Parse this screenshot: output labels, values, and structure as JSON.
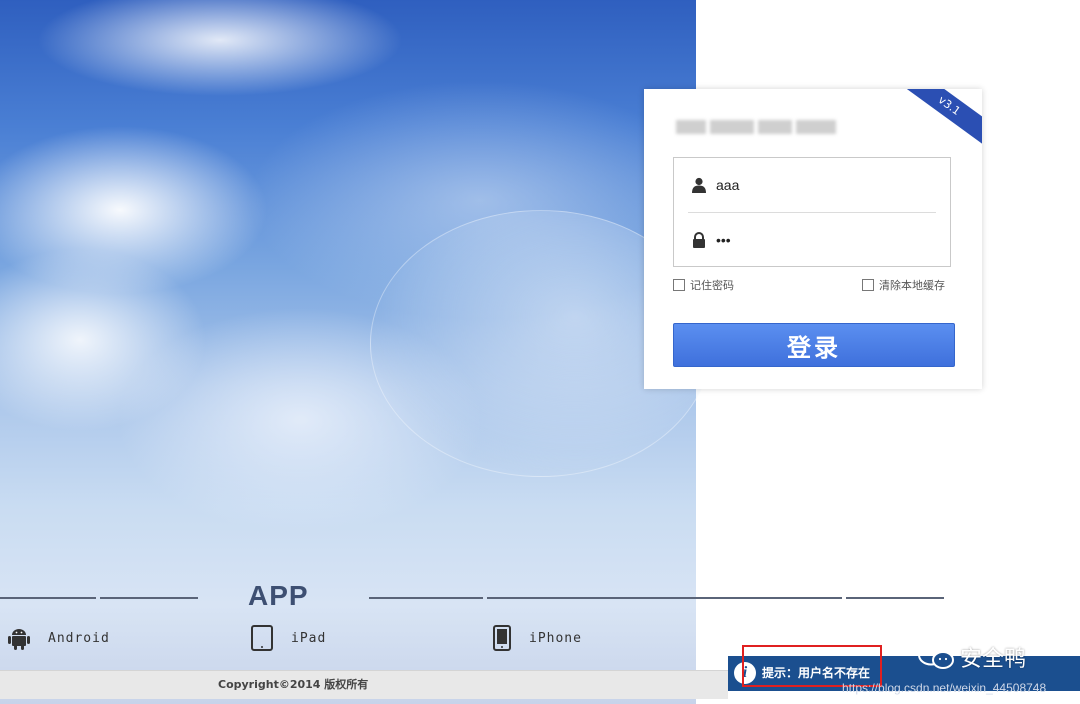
{
  "login": {
    "version_badge": "v3.1",
    "username_value": "aaa",
    "password_value": "•••",
    "remember_label": "记住密码",
    "clear_cache_label": "清除本地缓存",
    "login_button": "登录"
  },
  "app_section": {
    "title": "APP",
    "items": [
      {
        "label": "Android",
        "icon": "android-icon"
      },
      {
        "label": "iPad",
        "icon": "tablet-icon"
      },
      {
        "label": "iPhone",
        "icon": "phone-icon"
      }
    ]
  },
  "footer": {
    "copyright": "Copyright©2014  版权所有"
  },
  "alert": {
    "message": "提示：用户名不存在"
  },
  "watermark": {
    "text": "安全鸭",
    "url": "https://blog.csdn.net/weixin_44508748"
  }
}
